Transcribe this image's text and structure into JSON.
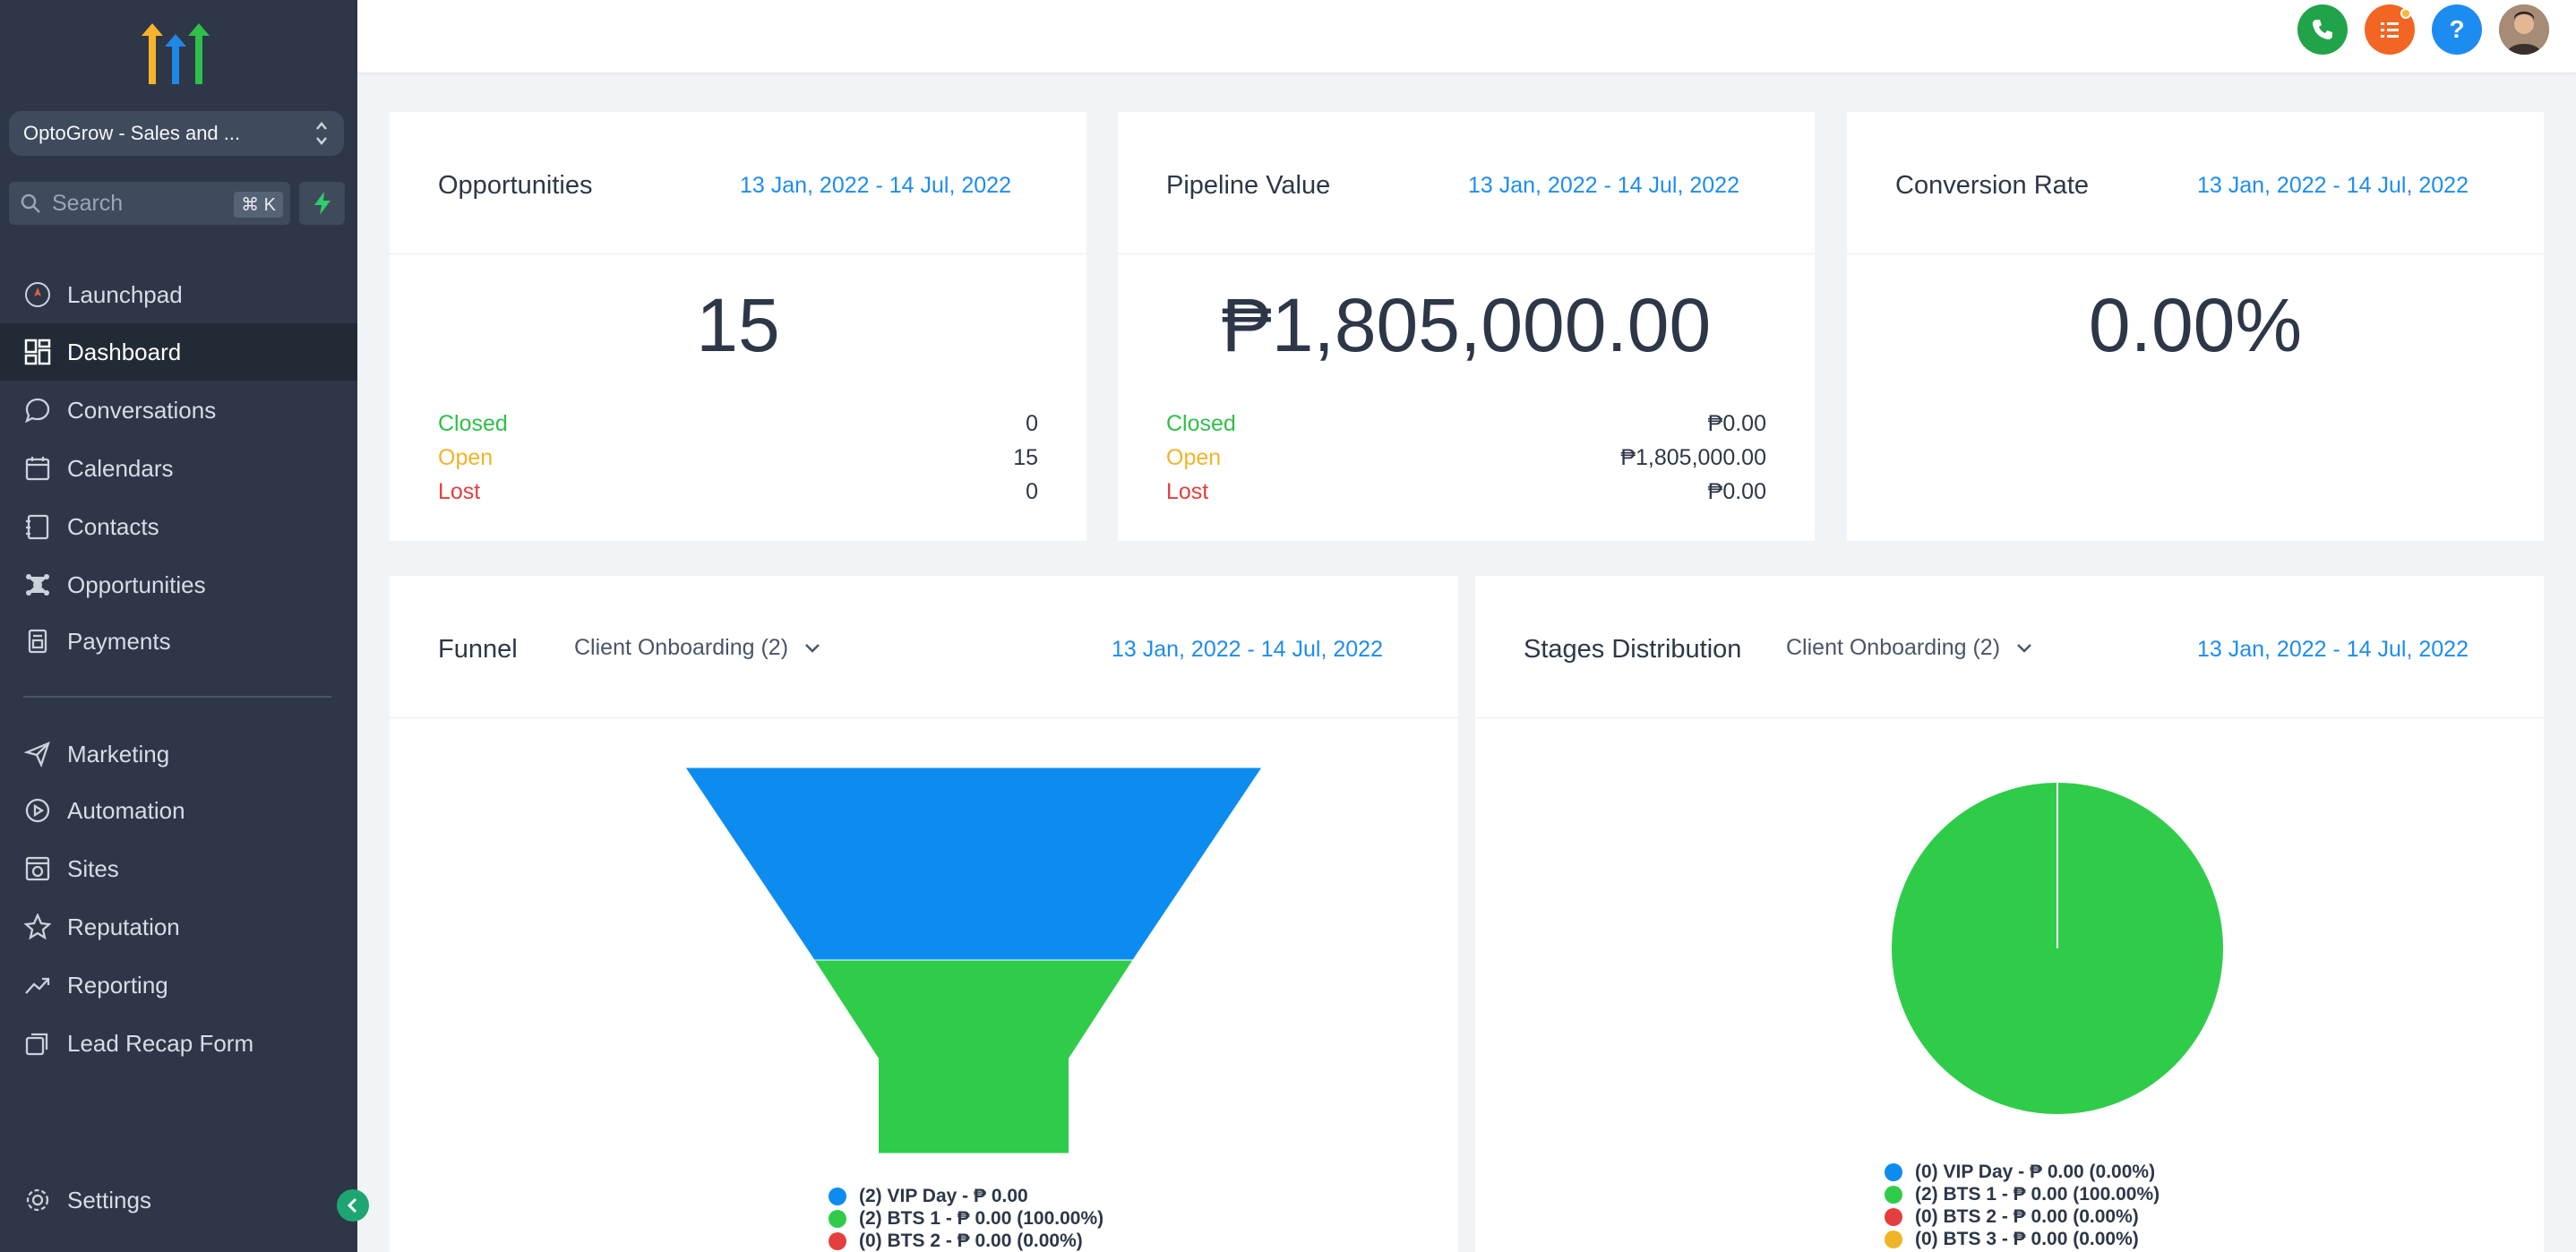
{
  "account": {
    "name": "OptoGrow - Sales and ..."
  },
  "search": {
    "placeholder": "Search",
    "shortcut": "⌘ K"
  },
  "nav": {
    "launchpad": "Launchpad",
    "dashboard": "Dashboard",
    "conversations": "Conversations",
    "calendars": "Calendars",
    "contacts": "Contacts",
    "opportunities": "Opportunities",
    "payments": "Payments",
    "marketing": "Marketing",
    "automation": "Automation",
    "sites": "Sites",
    "reputation": "Reputation",
    "reporting": "Reporting",
    "lead_recap": "Lead Recap Form",
    "settings": "Settings"
  },
  "topbar": {
    "icons": [
      "phone-icon",
      "list-icon",
      "help-icon",
      "avatar"
    ]
  },
  "colors": {
    "sidebar": "#2d3748",
    "accent": "#1d8cf0",
    "green": "#2fcc49",
    "blue": "#0d8cf0",
    "red": "#e53e3e",
    "orange": "#f0b429"
  },
  "cards": {
    "opportunities": {
      "title": "Opportunities",
      "date": "13 Jan, 2022 - 14 Jul, 2022",
      "value": "15",
      "closed_label": "Closed",
      "closed_value": "0",
      "open_label": "Open",
      "open_value": "15",
      "lost_label": "Lost",
      "lost_value": "0"
    },
    "pipeline": {
      "title": "Pipeline Value",
      "date": "13 Jan, 2022 - 14 Jul, 2022",
      "value": "₱1,805,000.00",
      "closed_label": "Closed",
      "closed_value": "₱0.00",
      "open_label": "Open",
      "open_value": "₱1,805,000.00",
      "lost_label": "Lost",
      "lost_value": "₱0.00"
    },
    "conversion": {
      "title": "Conversion Rate",
      "date": "13 Jan, 2022 - 14 Jul, 2022",
      "value": "0.00%"
    }
  },
  "funnel": {
    "title": "Funnel",
    "pipeline": "Client Onboarding (2)",
    "date": "13 Jan, 2022 - 14 Jul, 2022",
    "legend": [
      "(2) VIP Day - ₱ 0.00",
      "(2) BTS 1 - ₱ 0.00 (100.00%)",
      "(0) BTS 2 - ₱ 0.00 (0.00%)"
    ]
  },
  "stages": {
    "title": "Stages Distribution",
    "pipeline": "Client Onboarding (2)",
    "date": "13 Jan, 2022 - 14 Jul, 2022",
    "legend": [
      "(0) VIP Day - ₱ 0.00 (0.00%)",
      "(2) BTS 1 - ₱ 0.00 (100.00%)",
      "(0) BTS 2 - ₱ 0.00 (0.00%)",
      "(0) BTS 3 - ₱ 0.00 (0.00%)"
    ]
  },
  "chart_data": [
    {
      "type": "funnel",
      "title": "Funnel",
      "categories": [
        "VIP Day",
        "BTS 1",
        "BTS 2"
      ],
      "values": [
        2,
        2,
        0
      ],
      "colors": [
        "#0d8cf0",
        "#2fcc49",
        "#e53e3e"
      ]
    },
    {
      "type": "pie",
      "title": "Stages Distribution",
      "categories": [
        "VIP Day",
        "BTS 1",
        "BTS 2",
        "BTS 3"
      ],
      "values": [
        0,
        2,
        0,
        0
      ],
      "colors": [
        "#0d8cf0",
        "#2fcc49",
        "#e53e3e",
        "#f0b429"
      ]
    }
  ]
}
